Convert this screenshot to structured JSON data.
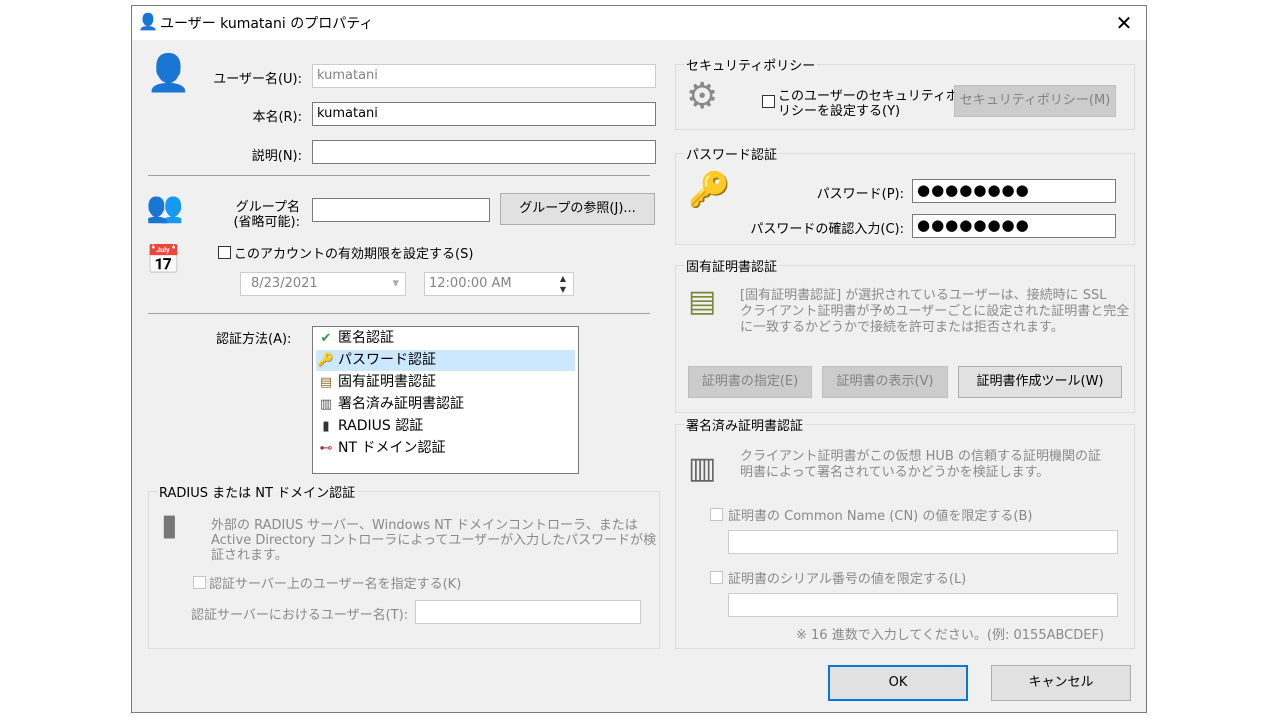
{
  "window": {
    "title": "ユーザー kumatani のプロパティ",
    "close_glyph": "✕"
  },
  "user": {
    "username_label": "ユーザー名(U):",
    "username_value": "kumatani",
    "realname_label": "本名(R):",
    "realname_value": "kumatani",
    "description_label": "説明(N):",
    "description_value": ""
  },
  "group": {
    "label_line1": "グループ名",
    "label_line2": "(省略可能):",
    "value": "",
    "browse_button": "グループの参照(J)..."
  },
  "expiry": {
    "checkbox_label": "このアカウントの有効期限を設定する(S)",
    "checked": false,
    "date_value": "8/23/2021",
    "time_value": "12:00:00 AM"
  },
  "auth": {
    "label": "認証方法(A):",
    "selected_index": 1,
    "methods": [
      {
        "label": "匿名認証",
        "icon": "check-circle-icon"
      },
      {
        "label": "パスワード認証",
        "icon": "keys-icon"
      },
      {
        "label": "固有証明書認証",
        "icon": "certificate-icon"
      },
      {
        "label": "署名済み証明書認証",
        "icon": "signed-certificate-icon"
      },
      {
        "label": "RADIUS 認証",
        "icon": "server-icon"
      },
      {
        "label": "NT ドメイン認証",
        "icon": "network-icon"
      }
    ]
  },
  "radius": {
    "group_title": "RADIUS または NT ドメイン認証",
    "desc_line1": "外部の RADIUS サーバー、Windows NT ドメインコントローラ、または",
    "desc_line2": "Active Directory コントローラによってユーザーが入力したパスワードが検",
    "desc_line3": "証されます。",
    "specify_checkbox": "認証サーバー上のユーザー名を指定する(K)",
    "server_user_label": "認証サーバーにおけるユーザー名(T):",
    "server_user_value": ""
  },
  "security_policy": {
    "group_title": "セキュリティポリシー",
    "checkbox_line1": "このユーザーのセキュリティポ",
    "checkbox_line2": "リシーを設定する(Y)",
    "button": "セキュリティポリシー(M)"
  },
  "password": {
    "group_title": "パスワード認証",
    "password_label": "パスワード(P):",
    "password_value": "●●●●●●●●",
    "confirm_label": "パスワードの確認入力(C):",
    "confirm_value": "●●●●●●●●"
  },
  "cert": {
    "group_title": "固有証明書認証",
    "desc_line1": "[固有証明書認証] が選択されているユーザーは、接続時に SSL",
    "desc_line2": "クライアント証明書が予めユーザーごとに設定された証明書と完全",
    "desc_line3": "に一致するかどうかで接続を許可または拒否されます。",
    "specify_button": "証明書の指定(E)",
    "view_button": "証明書の表示(V)",
    "tool_button": "証明書作成ツール(W)"
  },
  "signed": {
    "group_title": "署名済み証明書認証",
    "desc_line1": "クライアント証明書がこの仮想 HUB の信頼する証明機関の証",
    "desc_line2": "明書によって署名されているかどうかを検証します。",
    "cn_checkbox": "証明書の Common Name (CN) の値を限定する(B)",
    "cn_value": "",
    "serial_checkbox": "証明書のシリアル番号の値を限定する(L)",
    "serial_value": "",
    "hint": "※ 16 進数で入力してください。(例: 0155ABCDEF)"
  },
  "footer": {
    "ok": "OK",
    "cancel": "キャンセル"
  },
  "colors": {
    "dialog_bg": "#f0f0f0",
    "selection": "#cce8ff",
    "default_button_border": "#0078d7"
  }
}
